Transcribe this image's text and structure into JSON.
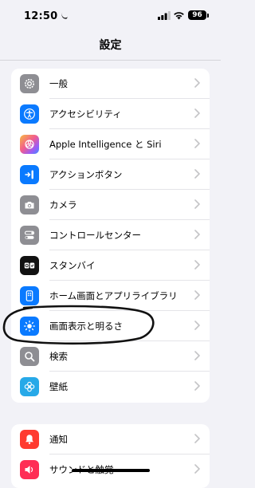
{
  "status_bar": {
    "time": "12:50",
    "battery_level": "96"
  },
  "nav": {
    "title": "設定"
  },
  "groups": [
    {
      "items": [
        {
          "label": "一般",
          "icon": "gear-icon",
          "color": "#8e8e93"
        },
        {
          "label": "アクセシビリティ",
          "icon": "accessibility-icon",
          "color": "#0a7aff"
        },
        {
          "label": "Apple Intelligence と Siri",
          "icon": "apple-intelligence-icon",
          "color": "#e0459a"
        },
        {
          "label": "アクションボタン",
          "icon": "action-button-icon",
          "color": "#0a7aff"
        },
        {
          "label": "カメラ",
          "icon": "camera-icon",
          "color": "#8e8e93"
        },
        {
          "label": "コントロールセンター",
          "icon": "control-center-icon",
          "color": "#8e8e93"
        },
        {
          "label": "スタンバイ",
          "icon": "standby-icon",
          "color": "#111111"
        },
        {
          "label": "ホーム画面とアプリライブラリ",
          "icon": "home-screen-icon",
          "color": "#0a7aff"
        },
        {
          "label": "画面表示と明るさ",
          "icon": "brightness-icon",
          "color": "#0a7aff"
        },
        {
          "label": "検索",
          "icon": "search-icon",
          "color": "#8e8e93"
        },
        {
          "label": "壁紙",
          "icon": "wallpaper-icon",
          "color": "#27a9e8"
        }
      ]
    },
    {
      "items": [
        {
          "label": "通知",
          "icon": "notifications-icon",
          "color": "#ff3b30"
        },
        {
          "label": "サウンドと触覚",
          "icon": "sound-icon",
          "color": "#ff2d55"
        }
      ]
    }
  ]
}
